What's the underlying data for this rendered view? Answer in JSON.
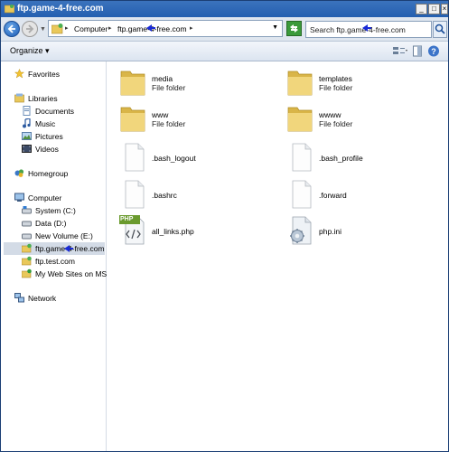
{
  "window": {
    "title": "ftp.game-4-free.com"
  },
  "address": {
    "crumbs": [
      "Computer",
      "ftp.game-4-free.com"
    ]
  },
  "search": {
    "placeholder": "Search ftp.game-4-free.com"
  },
  "toolbar": {
    "organize_label": "Organize"
  },
  "sidebar": {
    "favorites": "Favorites",
    "libraries": "Libraries",
    "documents": "Documents",
    "music": "Music",
    "pictures": "Pictures",
    "videos": "Videos",
    "homegroup": "Homegroup",
    "computer": "Computer",
    "system_c": "System (C:)",
    "data_d": "Data (D:)",
    "new_volume_e": "New Volume (E:)",
    "ftp_game": "ftp.game-4-free.com",
    "ftp_test": "ftp.test.com",
    "my_web_sites": "My Web Sites on MSN",
    "network": "Network"
  },
  "files": [
    {
      "name": "media",
      "type": "File folder"
    },
    {
      "name": "templates",
      "type": "File folder"
    },
    {
      "name": "www",
      "type": "File folder"
    },
    {
      "name": "wwww",
      "type": "File folder"
    },
    {
      "name": ".bash_logout",
      "type": ""
    },
    {
      "name": ".bash_profile",
      "type": ""
    },
    {
      "name": ".bashrc",
      "type": ""
    },
    {
      "name": ".forward",
      "type": ""
    },
    {
      "name": "all_links.php",
      "type": ""
    },
    {
      "name": "php.ini",
      "type": ""
    }
  ],
  "php_badge": "PHP"
}
